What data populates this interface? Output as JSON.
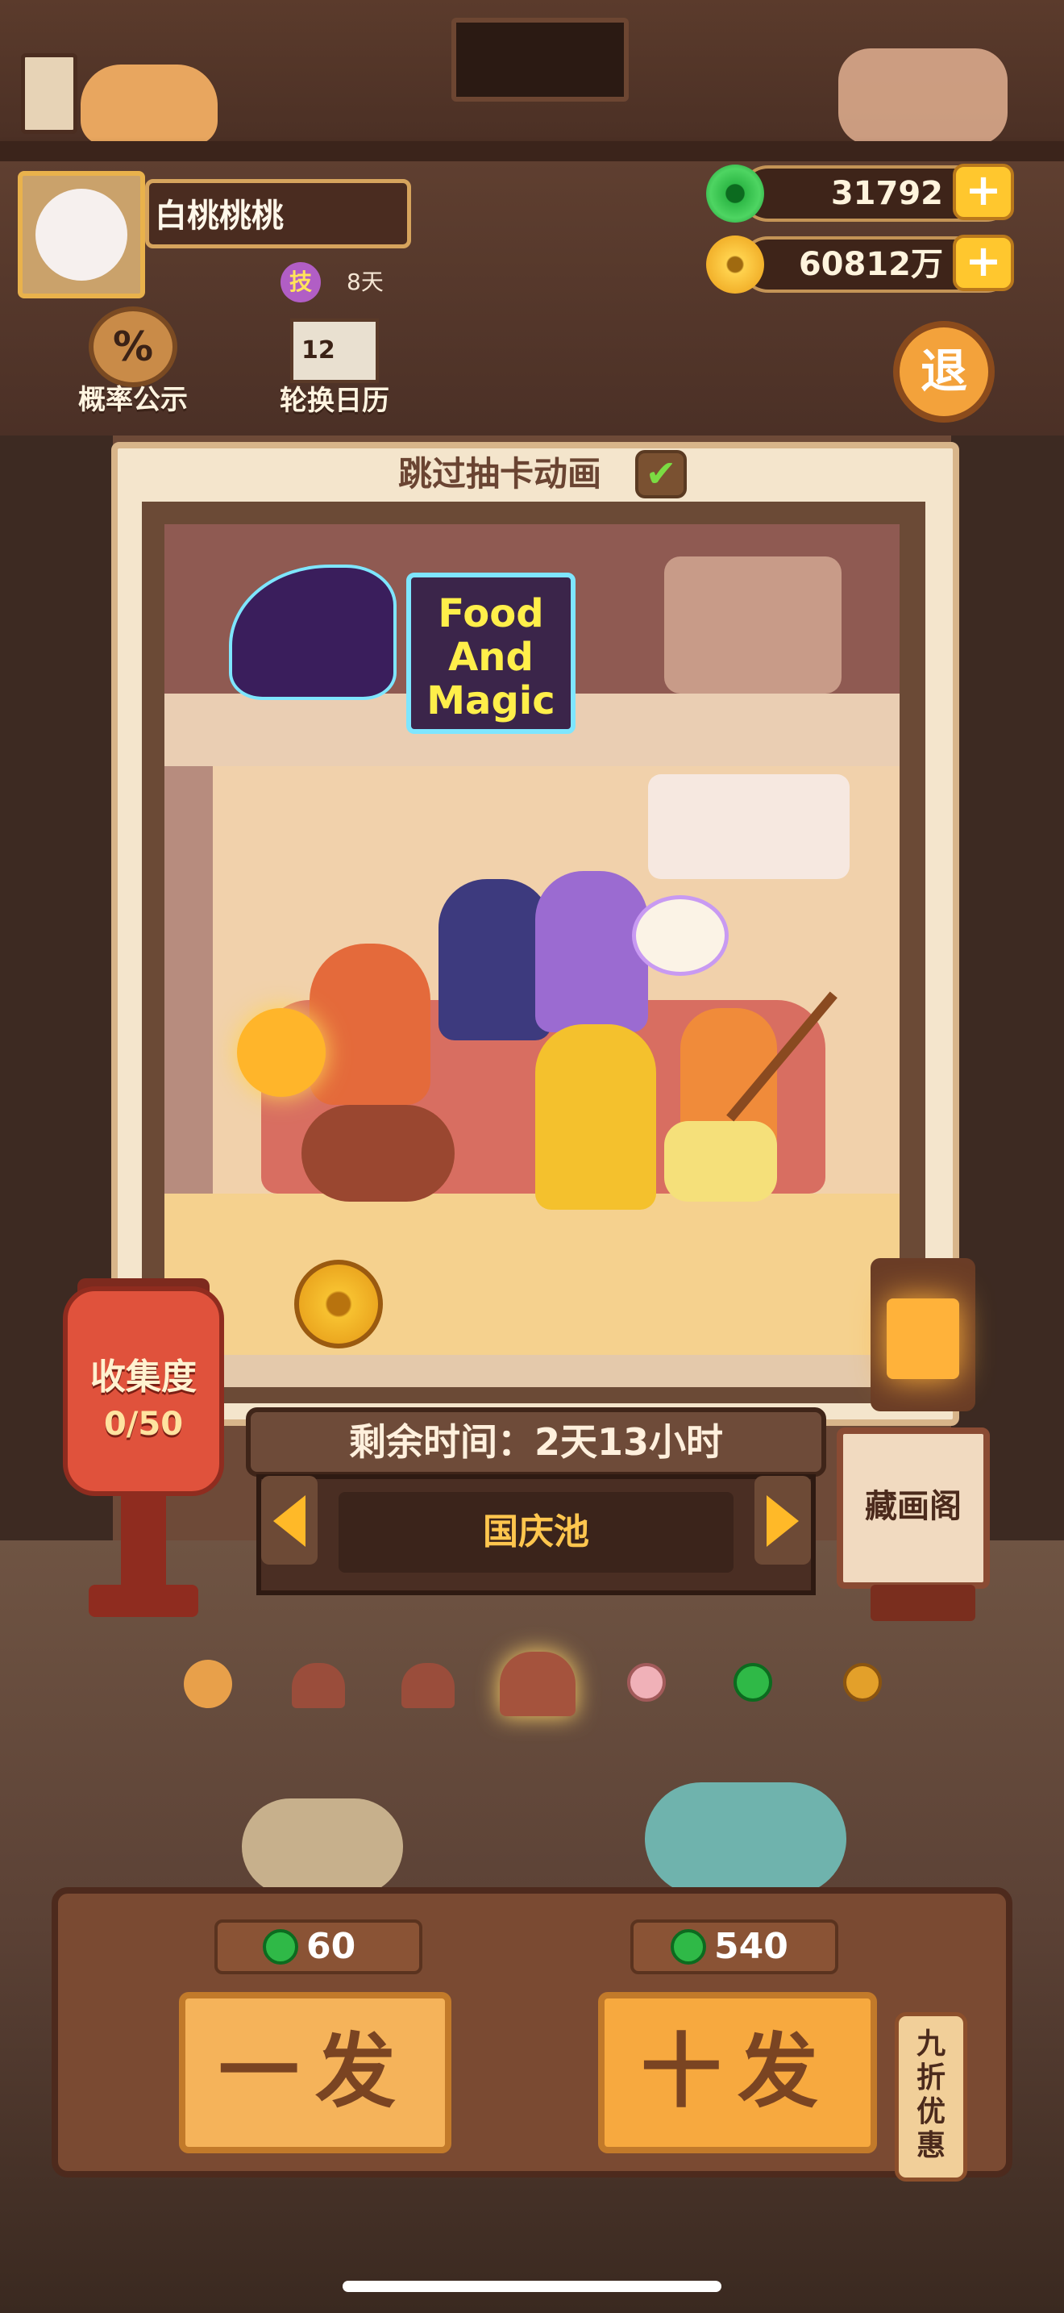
{
  "player": {
    "name": "白桃桃桃",
    "skill_badge": "技",
    "days": "8天"
  },
  "currency": {
    "jade": "31792",
    "coin": "60812万",
    "plus": "+"
  },
  "menu": {
    "probability": "概率公示",
    "probability_icon": "%",
    "rotation_calendar": "轮换日历",
    "calendar_icon": "12",
    "exit": "退"
  },
  "gacha": {
    "skip_animation": "跳过抽卡动画",
    "skip_checked": "✔",
    "banner_title": "Food\nAnd\nMagic",
    "collection_label": "收集度",
    "collection_count": "0/50",
    "remaining_time": "剩余时间：2天13小时",
    "pool_name": "国庆池",
    "gallery": "藏画阁"
  },
  "pool_tabs": [
    {
      "icon": "lantern-icon",
      "color": "#e8a04a",
      "selected": false
    },
    {
      "icon": "house-icon",
      "color": "#9a4d3b",
      "selected": false
    },
    {
      "icon": "house-icon",
      "color": "#9a4d3b",
      "selected": false
    },
    {
      "icon": "house-icon",
      "color": "#9a4d3b",
      "selected": true
    },
    {
      "icon": "plus-coin-icon",
      "color": "#f0b1b8",
      "selected": false
    },
    {
      "icon": "jade-icon",
      "color": "#2fb947",
      "selected": false
    },
    {
      "icon": "coin-icon",
      "color": "#e3a02a",
      "selected": false
    }
  ],
  "draw": {
    "single_price": "60",
    "single_label": "一发",
    "ten_price": "540",
    "ten_label": "十发",
    "discount": "九折优惠"
  }
}
